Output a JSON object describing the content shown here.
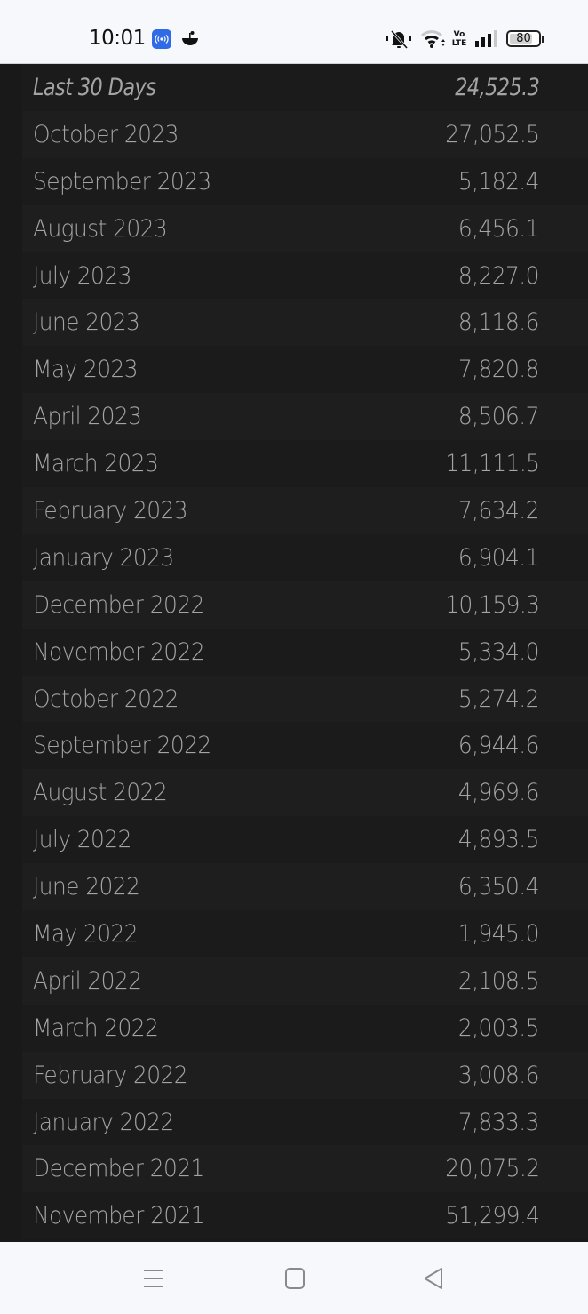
{
  "status_bar": {
    "time": "10:01",
    "icons": [
      "hotspot-icon",
      "app-notification-icon",
      "mute-icon",
      "wifi-icon",
      "volte-icon",
      "signal-icon",
      "battery-icon"
    ],
    "volte_line1": "Vo",
    "volte_line2": "LTE",
    "battery_level": "80",
    "battery_percent": 80
  },
  "list": {
    "rows": [
      {
        "label": "Last 30 Days",
        "value": "24,525.3",
        "italic": true
      },
      {
        "label": "October 2023",
        "value": "27,052.5"
      },
      {
        "label": "September 2023",
        "value": "5,182.4"
      },
      {
        "label": "August 2023",
        "value": "6,456.1"
      },
      {
        "label": "July 2023",
        "value": "8,227.0"
      },
      {
        "label": "June 2023",
        "value": "8,118.6"
      },
      {
        "label": "May 2023",
        "value": "7,820.8"
      },
      {
        "label": "April 2023",
        "value": "8,506.7"
      },
      {
        "label": "March 2023",
        "value": "11,111.5"
      },
      {
        "label": "February 2023",
        "value": "7,634.2"
      },
      {
        "label": "January 2023",
        "value": "6,904.1"
      },
      {
        "label": "December 2022",
        "value": "10,159.3"
      },
      {
        "label": "November 2022",
        "value": "5,334.0"
      },
      {
        "label": "October 2022",
        "value": "5,274.2"
      },
      {
        "label": "September 2022",
        "value": "6,944.6"
      },
      {
        "label": "August 2022",
        "value": "4,969.6"
      },
      {
        "label": "July 2022",
        "value": "4,893.5"
      },
      {
        "label": "June 2022",
        "value": "6,350.4"
      },
      {
        "label": "May 2022",
        "value": "1,945.0"
      },
      {
        "label": "April 2022",
        "value": "2,108.5"
      },
      {
        "label": "March 2022",
        "value": "2,003.5"
      },
      {
        "label": "February 2022",
        "value": "3,008.6"
      },
      {
        "label": "January 2022",
        "value": "7,833.3"
      },
      {
        "label": "December 2021",
        "value": "20,075.2"
      },
      {
        "label": "November 2021",
        "value": "51,299.4"
      }
    ]
  },
  "nav_bar": {
    "buttons": [
      "recents",
      "home",
      "back"
    ]
  },
  "colors": {
    "hotspot_badge": "#2f6be6",
    "list_text": "#a4a4a4",
    "row_odd": "#1b1b1b",
    "row_even": "#1e1e1e",
    "system_bar": "#f6f8fc"
  }
}
